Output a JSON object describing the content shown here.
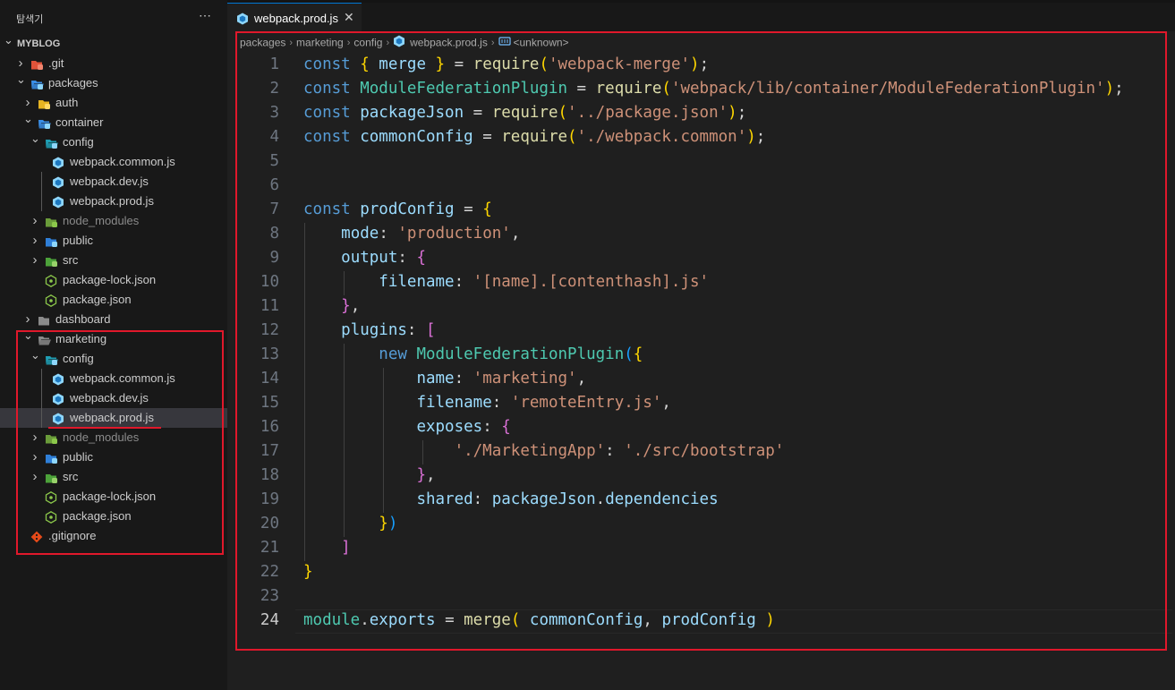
{
  "explorer": {
    "title": "탐색기",
    "more": "⋯",
    "tree": [
      {
        "label": "MYBLOG",
        "depth": 0,
        "chevron": "down",
        "icon": "none",
        "root": true
      },
      {
        "label": ".git",
        "depth": 1,
        "chevron": "right",
        "icon": "folder-git-icon"
      },
      {
        "label": "packages",
        "depth": 1,
        "chevron": "down",
        "icon": "folder-packages-icon"
      },
      {
        "label": "auth",
        "depth": 2,
        "chevron": "right",
        "icon": "folder-yellow-icon"
      },
      {
        "label": "container",
        "depth": 2,
        "chevron": "down",
        "icon": "folder-container-icon"
      },
      {
        "label": "config",
        "depth": 3,
        "chevron": "down",
        "icon": "folder-config-icon"
      },
      {
        "label": "webpack.common.js",
        "depth": 4,
        "chevron": "none",
        "icon": "webpack-icon"
      },
      {
        "label": "webpack.dev.js",
        "depth": 4,
        "chevron": "none",
        "icon": "webpack-icon"
      },
      {
        "label": "webpack.prod.js",
        "depth": 4,
        "chevron": "none",
        "icon": "webpack-icon"
      },
      {
        "label": "node_modules",
        "depth": 3,
        "chevron": "right",
        "icon": "folder-node-icon",
        "dim": true
      },
      {
        "label": "public",
        "depth": 3,
        "chevron": "right",
        "icon": "folder-public-icon"
      },
      {
        "label": "src",
        "depth": 3,
        "chevron": "right",
        "icon": "folder-src-icon"
      },
      {
        "label": "package-lock.json",
        "depth": 3,
        "chevron": "none",
        "icon": "nodejs-file-icon"
      },
      {
        "label": "package.json",
        "depth": 3,
        "chevron": "none",
        "icon": "nodejs-file-icon"
      },
      {
        "label": "dashboard",
        "depth": 2,
        "chevron": "right",
        "icon": "folder-gray-icon"
      },
      {
        "label": "marketing",
        "depth": 2,
        "chevron": "down",
        "icon": "folder-gray-open-icon"
      },
      {
        "label": "config",
        "depth": 3,
        "chevron": "down",
        "icon": "folder-config-icon"
      },
      {
        "label": "webpack.common.js",
        "depth": 4,
        "chevron": "none",
        "icon": "webpack-icon"
      },
      {
        "label": "webpack.dev.js",
        "depth": 4,
        "chevron": "none",
        "icon": "webpack-icon"
      },
      {
        "label": "webpack.prod.js",
        "depth": 4,
        "chevron": "none",
        "icon": "webpack-icon",
        "selected": true
      },
      {
        "label": "node_modules",
        "depth": 3,
        "chevron": "right",
        "icon": "folder-node-icon",
        "dim": true
      },
      {
        "label": "public",
        "depth": 3,
        "chevron": "right",
        "icon": "folder-public-icon"
      },
      {
        "label": "src",
        "depth": 3,
        "chevron": "right",
        "icon": "folder-src-icon"
      },
      {
        "label": "package-lock.json",
        "depth": 3,
        "chevron": "none",
        "icon": "nodejs-file-icon"
      },
      {
        "label": "package.json",
        "depth": 3,
        "chevron": "none",
        "icon": "nodejs-file-icon"
      },
      {
        "label": ".gitignore",
        "depth": 1,
        "chevron": "none",
        "icon": "git-file-icon"
      }
    ]
  },
  "tab": {
    "label": "webpack.prod.js",
    "close": "✕",
    "icon": "webpack-icon"
  },
  "breadcrumb": {
    "items": [
      "packages",
      "marketing",
      "config",
      "webpack.prod.js",
      "<unknown>"
    ],
    "separator": "›"
  },
  "editor": {
    "active_line": 24,
    "lines": [
      [
        [
          "k",
          "const "
        ],
        [
          "b1",
          "{ "
        ],
        [
          "v",
          "merge "
        ],
        [
          "b1",
          "}"
        ],
        [
          "p",
          " = "
        ],
        [
          "f",
          "require"
        ],
        [
          "b1",
          "("
        ],
        [
          "s",
          "'webpack-merge'"
        ],
        [
          "b1",
          ")"
        ],
        [
          "p",
          ";"
        ]
      ],
      [
        [
          "k",
          "const "
        ],
        [
          "c",
          "ModuleFederationPlugin"
        ],
        [
          "p",
          " = "
        ],
        [
          "f",
          "require"
        ],
        [
          "b1",
          "("
        ],
        [
          "s",
          "'webpack/lib/container/ModuleFederationPlugin'"
        ],
        [
          "b1",
          ")"
        ],
        [
          "p",
          ";"
        ]
      ],
      [
        [
          "k",
          "const "
        ],
        [
          "v",
          "packageJson"
        ],
        [
          "p",
          " = "
        ],
        [
          "f",
          "require"
        ],
        [
          "b1",
          "("
        ],
        [
          "s",
          "'../package.json'"
        ],
        [
          "b1",
          ")"
        ],
        [
          "p",
          ";"
        ]
      ],
      [
        [
          "k",
          "const "
        ],
        [
          "v",
          "commonConfig"
        ],
        [
          "p",
          " = "
        ],
        [
          "f",
          "require"
        ],
        [
          "b1",
          "("
        ],
        [
          "s",
          "'./webpack.common'"
        ],
        [
          "b1",
          ")"
        ],
        [
          "p",
          ";"
        ]
      ],
      [],
      [],
      [
        [
          "k",
          "const "
        ],
        [
          "v",
          "prodConfig"
        ],
        [
          "p",
          " = "
        ],
        [
          "b1",
          "{"
        ]
      ],
      [
        [
          "p",
          "    "
        ],
        [
          "v",
          "mode"
        ],
        [
          "p",
          ": "
        ],
        [
          "s",
          "'production'"
        ],
        [
          "p",
          ","
        ]
      ],
      [
        [
          "p",
          "    "
        ],
        [
          "v",
          "output"
        ],
        [
          "p",
          ": "
        ],
        [
          "b2",
          "{"
        ]
      ],
      [
        [
          "p",
          "        "
        ],
        [
          "v",
          "filename"
        ],
        [
          "p",
          ": "
        ],
        [
          "s",
          "'[name].[contenthash].js'"
        ]
      ],
      [
        [
          "p",
          "    "
        ],
        [
          "b2",
          "}"
        ],
        [
          "p",
          ","
        ]
      ],
      [
        [
          "p",
          "    "
        ],
        [
          "v",
          "plugins"
        ],
        [
          "p",
          ": "
        ],
        [
          "b2",
          "["
        ]
      ],
      [
        [
          "p",
          "        "
        ],
        [
          "k",
          "new "
        ],
        [
          "c",
          "ModuleFederationPlugin"
        ],
        [
          "b3",
          "("
        ],
        [
          "b1",
          "{"
        ]
      ],
      [
        [
          "p",
          "            "
        ],
        [
          "v",
          "name"
        ],
        [
          "p",
          ": "
        ],
        [
          "s",
          "'marketing'"
        ],
        [
          "p",
          ","
        ]
      ],
      [
        [
          "p",
          "            "
        ],
        [
          "v",
          "filename"
        ],
        [
          "p",
          ": "
        ],
        [
          "s",
          "'remoteEntry.js'"
        ],
        [
          "p",
          ","
        ]
      ],
      [
        [
          "p",
          "            "
        ],
        [
          "v",
          "exposes"
        ],
        [
          "p",
          ": "
        ],
        [
          "b2",
          "{"
        ]
      ],
      [
        [
          "p",
          "                "
        ],
        [
          "s",
          "'./MarketingApp'"
        ],
        [
          "p",
          ": "
        ],
        [
          "s",
          "'./src/bootstrap'"
        ]
      ],
      [
        [
          "p",
          "            "
        ],
        [
          "b2",
          "}"
        ],
        [
          "p",
          ","
        ]
      ],
      [
        [
          "p",
          "            "
        ],
        [
          "v",
          "shared"
        ],
        [
          "p",
          ": "
        ],
        [
          "v",
          "packageJson"
        ],
        [
          "p",
          "."
        ],
        [
          "v",
          "dependencies"
        ]
      ],
      [
        [
          "p",
          "        "
        ],
        [
          "b1",
          "}"
        ],
        [
          "b3",
          ")"
        ]
      ],
      [
        [
          "p",
          "    "
        ],
        [
          "b2",
          "]"
        ]
      ],
      [
        [
          "b1",
          "}"
        ]
      ],
      [],
      [
        [
          "c",
          "module"
        ],
        [
          "p",
          "."
        ],
        [
          "v",
          "exports"
        ],
        [
          "p",
          " = "
        ],
        [
          "f",
          "merge"
        ],
        [
          "b1",
          "("
        ],
        [
          "p",
          " "
        ],
        [
          "v",
          "commonConfig"
        ],
        [
          "p",
          ", "
        ],
        [
          "v",
          "prodConfig"
        ],
        [
          "p",
          " "
        ],
        [
          "b1",
          ")"
        ]
      ]
    ]
  }
}
